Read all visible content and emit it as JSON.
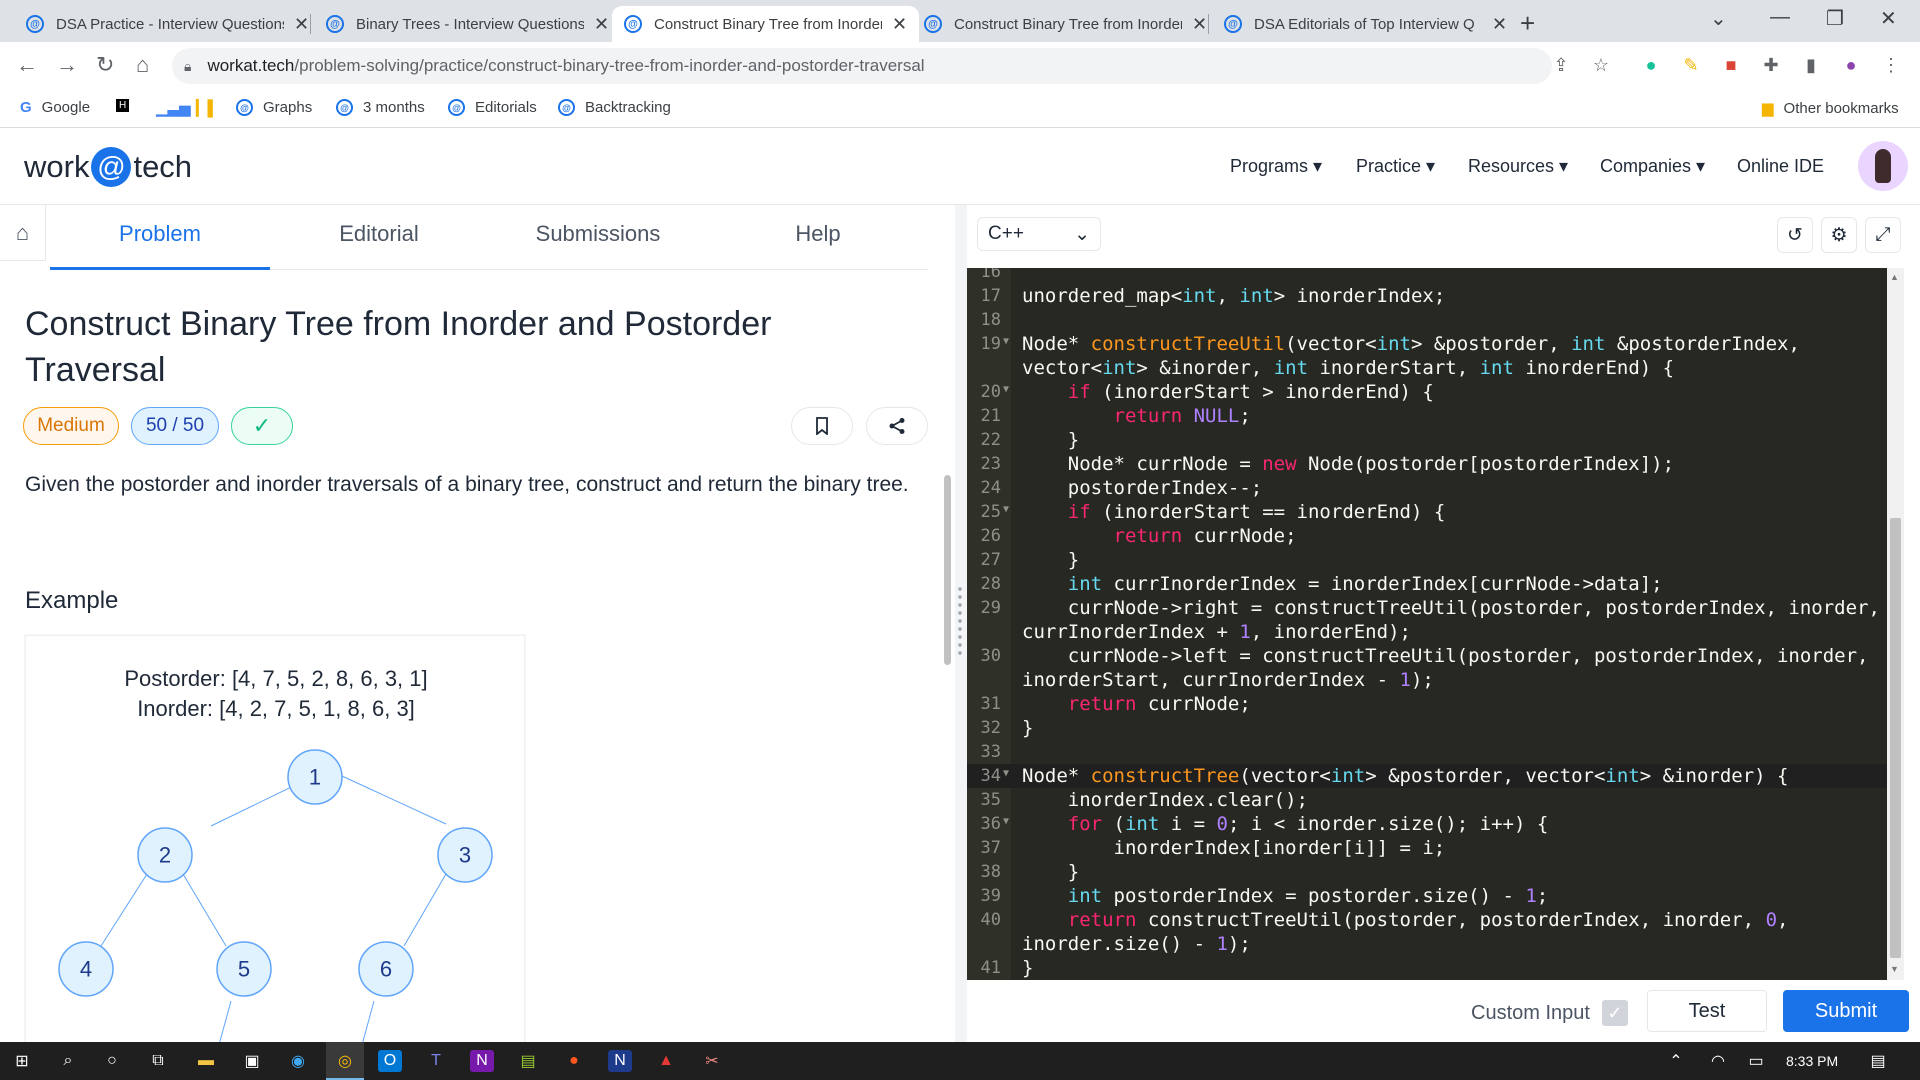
{
  "browser": {
    "tabs": [
      {
        "title": "DSA Practice - Interview Questions",
        "active": false
      },
      {
        "title": "Binary Trees - Interview Questions",
        "active": false
      },
      {
        "title": "Construct Binary Tree from Inorder",
        "active": true
      },
      {
        "title": "Construct Binary Tree from Inorder",
        "active": false
      },
      {
        "title": "DSA Editorials of Top Interview Q",
        "active": false
      }
    ],
    "url_host": "workat.tech",
    "url_path": "/problem-solving/practice/construct-binary-tree-from-inorder-and-postorder-traversal",
    "bookmarks": [
      "Google",
      "Graphs",
      "3 months",
      "Editorials",
      "Backtracking"
    ],
    "other_bookmarks": "Other bookmarks"
  },
  "site": {
    "logo_left": "work",
    "logo_at": "@",
    "logo_right": "tech",
    "nav": [
      "Programs ▾",
      "Practice ▾",
      "Resources ▾",
      "Companies ▾",
      "Online IDE"
    ]
  },
  "problem": {
    "tabs": [
      "Problem",
      "Editorial",
      "Submissions",
      "Help"
    ],
    "title": "Construct Binary Tree from Inorder and Postorder Traversal",
    "difficulty": "Medium",
    "score": "50 / 50",
    "description": "Given the postorder and inorder traversals of a binary tree, construct and return the binary tree.",
    "example_heading": "Example",
    "example_postorder": "Postorder: [4, 7, 5, 2, 8, 6, 3, 1]",
    "example_inorder": "Inorder: [4, 2, 7, 5, 1, 8, 6, 3]",
    "tree_nodes": [
      "1",
      "2",
      "3",
      "4",
      "5",
      "6"
    ]
  },
  "editor": {
    "language": "C++",
    "custom_input_label": "Custom Input",
    "test_label": "Test",
    "submit_label": "Submit",
    "line_numbers": [
      "16",
      "17",
      "18",
      "19",
      "",
      "20",
      "21",
      "22",
      "23",
      "24",
      "25",
      "26",
      "27",
      "28",
      "29",
      "",
      "30",
      "",
      "31",
      "32",
      "33",
      "34",
      "35",
      "36",
      "37",
      "38",
      "39",
      "40",
      "",
      "41"
    ]
  },
  "taskbar": {
    "time": "8:33 PM"
  },
  "colors": {
    "accent": "#1a73e8",
    "editor_bg": "#272822",
    "difficulty_medium": "#d97706"
  }
}
